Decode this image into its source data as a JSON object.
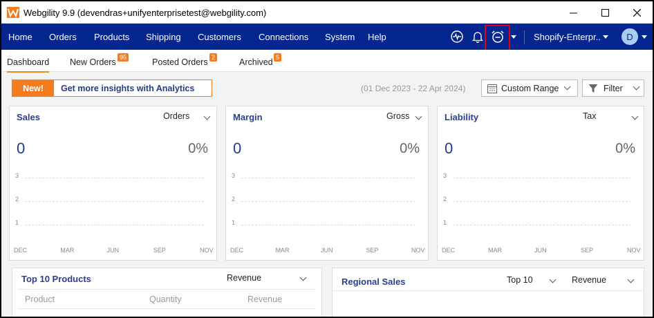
{
  "window": {
    "title": "Webgility 9.9 (devendras+unifyenterprisetest@webgility.com)"
  },
  "nav": {
    "items": [
      "Home",
      "Orders",
      "Products",
      "Shipping",
      "Customers",
      "Connections",
      "System",
      "Help"
    ],
    "store": "Shopify-Enterpr..",
    "avatar": "D"
  },
  "tabs": [
    {
      "label": "Dashboard"
    },
    {
      "label": "New Orders",
      "badge": "95"
    },
    {
      "label": "Posted Orders",
      "badge": "2"
    },
    {
      "label": "Archived",
      "badge": "5"
    }
  ],
  "toolbar": {
    "promo_badge": "New!",
    "promo_text": "Get more insights with Analytics",
    "date_range": "(01 Dec 2023 - 22 Apr 2024)",
    "range_select": "Custom Range",
    "filter_label": "Filter"
  },
  "cards": [
    {
      "title": "Sales",
      "select": "Orders",
      "value": "0",
      "percent": "0%"
    },
    {
      "title": "Margin",
      "select": "Gross",
      "value": "0",
      "percent": "0%"
    },
    {
      "title": "Liability",
      "select": "Tax",
      "value": "0",
      "percent": "0%"
    }
  ],
  "chart_yticks": [
    "3",
    "2",
    "1"
  ],
  "chart_xticks": [
    "DEC",
    "MAR",
    "JUN",
    "SEP",
    "NOV"
  ],
  "top_products": {
    "title": "Top 10 Products",
    "select": "Revenue",
    "columns": [
      "Product",
      "Quantity",
      "Revenue"
    ]
  },
  "regional_sales": {
    "title": "Regional Sales",
    "top_select": "Top 10",
    "metric_select": "Revenue"
  },
  "colors": {
    "nav_bg": "#06268f",
    "accent": "#f47b20",
    "highlight": "#e0001a"
  }
}
